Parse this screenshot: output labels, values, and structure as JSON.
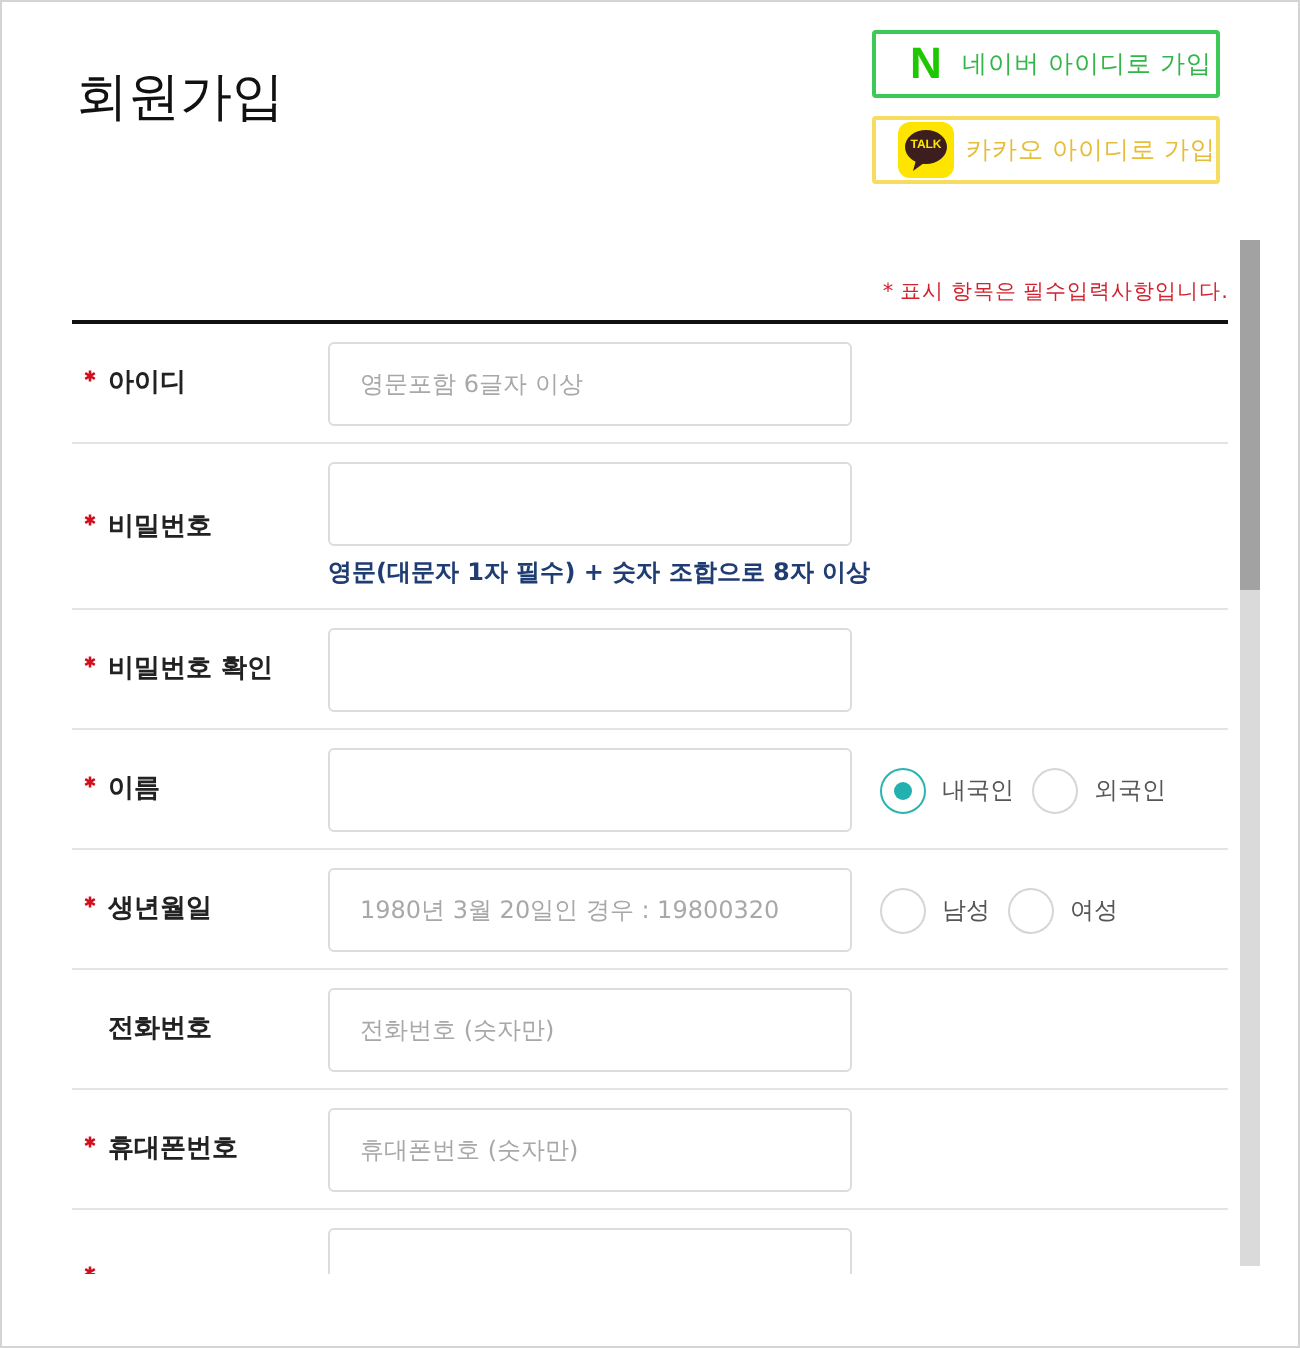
{
  "page": {
    "title": "회원가입"
  },
  "social_buttons": [
    {
      "kind": "naver",
      "logo": "N",
      "label": "네이버 아이디로 가입"
    },
    {
      "kind": "kakao",
      "logo": "TALK",
      "label": "카카오 아이디로 가입"
    }
  ],
  "form": {
    "required_note": "* 표시 항목은 필수입력사항입니다.",
    "fields": [
      {
        "label": "아이디",
        "required": true,
        "placeholder": "영문포함 6글자 이상"
      },
      {
        "label": "비밀번호",
        "required": true,
        "help": "영문(대문자 1자 필수) + 숫자 조합으로 8자 이상"
      },
      {
        "label": "비밀번호 확인",
        "required": true
      },
      {
        "label": "이름",
        "required": true,
        "options": [
          {
            "label": "내국인",
            "selected": true
          },
          {
            "label": "외국인",
            "selected": false
          }
        ]
      },
      {
        "label": "생년월일",
        "required": true,
        "placeholder": "1980년 3월 20일인 경우 : 19800320",
        "options": [
          {
            "label": "남성",
            "selected": false
          },
          {
            "label": "여성",
            "selected": false
          }
        ]
      },
      {
        "label": "전화번호",
        "required": false,
        "placeholder": "전화번호 (숫자만)"
      },
      {
        "label": "휴대폰번호",
        "required": true,
        "placeholder": "휴대폰번호 (숫자만)"
      },
      {
        "required": true
      }
    ]
  }
}
